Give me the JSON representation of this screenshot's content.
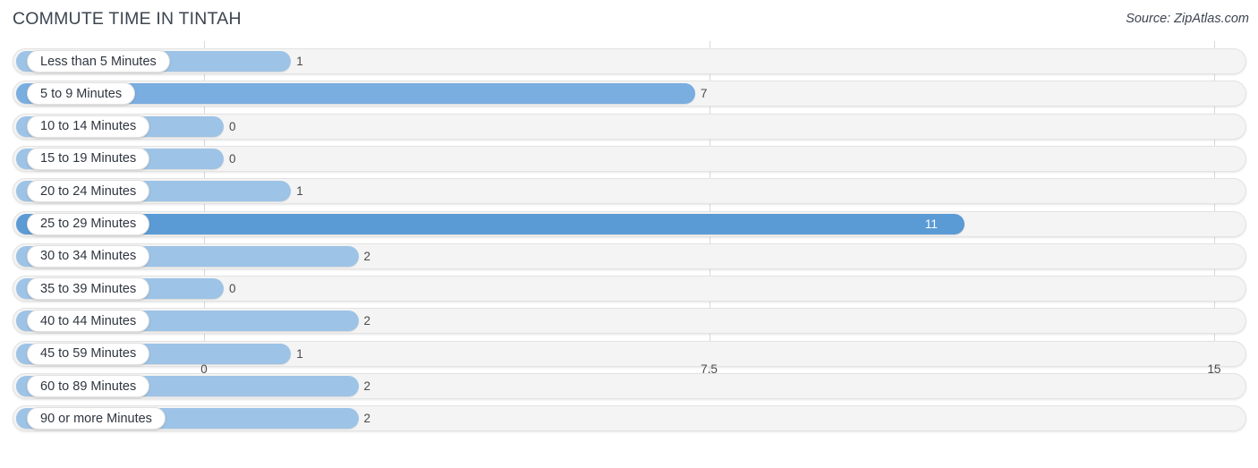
{
  "header": {
    "title": "COMMUTE TIME IN TINTAH",
    "source": "Source: ZipAtlas.com"
  },
  "colors": {
    "bar_light": "#9dc3e6",
    "bar_medium": "#7aade0",
    "bar_dark": "#5b9bd5",
    "track": "#f4f4f4",
    "gridline": "#d9d9d9",
    "text": "#3c4551"
  },
  "chart_data": {
    "type": "bar",
    "orientation": "horizontal",
    "title": "COMMUTE TIME IN TINTAH",
    "xlabel": "",
    "ylabel": "",
    "xlim": [
      0,
      15
    ],
    "grid": true,
    "legend": null,
    "axis_ticks": [
      "0",
      "7.5",
      "15"
    ],
    "axis_tick_values": [
      0,
      7.5,
      15
    ],
    "categories": [
      "Less than 5 Minutes",
      "5 to 9 Minutes",
      "10 to 14 Minutes",
      "15 to 19 Minutes",
      "20 to 24 Minutes",
      "25 to 29 Minutes",
      "30 to 34 Minutes",
      "35 to 39 Minutes",
      "40 to 44 Minutes",
      "45 to 59 Minutes",
      "60 to 89 Minutes",
      "90 or more Minutes"
    ],
    "values": [
      1,
      7,
      0,
      0,
      1,
      11,
      2,
      0,
      2,
      1,
      2,
      2
    ],
    "value_labels": [
      "1",
      "7",
      "0",
      "0",
      "1",
      "11",
      "2",
      "0",
      "2",
      "1",
      "2",
      "2"
    ],
    "bars": [
      {
        "label": "Less than 5 Minutes",
        "value": 1,
        "value_label": "1",
        "color": "#9dc3e6",
        "label_inside": false
      },
      {
        "label": "5 to 9 Minutes",
        "value": 7,
        "value_label": "7",
        "color": "#7aade0",
        "label_inside": false
      },
      {
        "label": "10 to 14 Minutes",
        "value": 0,
        "value_label": "0",
        "color": "#9dc3e6",
        "label_inside": false
      },
      {
        "label": "15 to 19 Minutes",
        "value": 0,
        "value_label": "0",
        "color": "#9dc3e6",
        "label_inside": false
      },
      {
        "label": "20 to 24 Minutes",
        "value": 1,
        "value_label": "1",
        "color": "#9dc3e6",
        "label_inside": false
      },
      {
        "label": "25 to 29 Minutes",
        "value": 11,
        "value_label": "11",
        "color": "#5b9bd5",
        "label_inside": true
      },
      {
        "label": "30 to 34 Minutes",
        "value": 2,
        "value_label": "2",
        "color": "#9dc3e6",
        "label_inside": false
      },
      {
        "label": "35 to 39 Minutes",
        "value": 0,
        "value_label": "0",
        "color": "#9dc3e6",
        "label_inside": false
      },
      {
        "label": "40 to 44 Minutes",
        "value": 2,
        "value_label": "2",
        "color": "#9dc3e6",
        "label_inside": false
      },
      {
        "label": "45 to 59 Minutes",
        "value": 1,
        "value_label": "1",
        "color": "#9dc3e6",
        "label_inside": false
      },
      {
        "label": "60 to 89 Minutes",
        "value": 2,
        "value_label": "2",
        "color": "#9dc3e6",
        "label_inside": false
      },
      {
        "label": "90 or more Minutes",
        "value": 2,
        "value_label": "2",
        "color": "#9dc3e6",
        "label_inside": false
      }
    ]
  }
}
